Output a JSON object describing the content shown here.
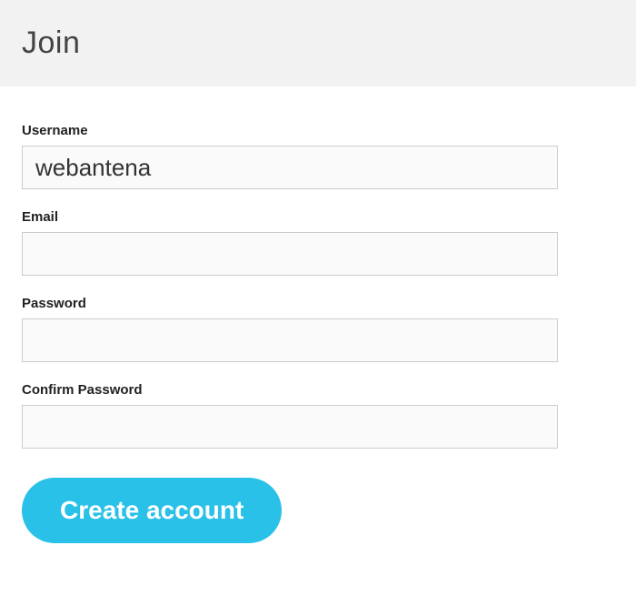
{
  "header": {
    "title": "Join"
  },
  "form": {
    "username": {
      "label": "Username",
      "value": "webantena"
    },
    "email": {
      "label": "Email",
      "value": ""
    },
    "password": {
      "label": "Password",
      "value": ""
    },
    "confirm_password": {
      "label": "Confirm Password",
      "value": ""
    },
    "submit_label": "Create account"
  }
}
